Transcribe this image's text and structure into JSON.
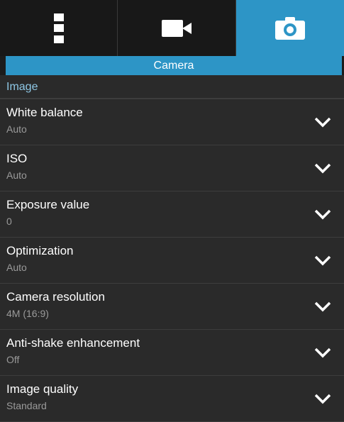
{
  "tabs": [
    {
      "icon": "more-icon"
    },
    {
      "icon": "video-camera-icon"
    },
    {
      "icon": "camera-icon",
      "active": true
    }
  ],
  "section_title": "Camera",
  "group_title": "Image",
  "settings": [
    {
      "title": "White balance",
      "value": "Auto"
    },
    {
      "title": "ISO",
      "value": "Auto"
    },
    {
      "title": "Exposure value",
      "value": "0"
    },
    {
      "title": "Optimization",
      "value": "Auto"
    },
    {
      "title": "Camera resolution",
      "value": "4M (16:9)"
    },
    {
      "title": "Anti-shake enhancement",
      "value": "Off"
    },
    {
      "title": "Image quality",
      "value": "Standard"
    }
  ],
  "colors": {
    "accent": "#2d95c6",
    "background": "#1c1c1c",
    "row": "#2a2a2a",
    "group_text": "#8fc8e6"
  }
}
